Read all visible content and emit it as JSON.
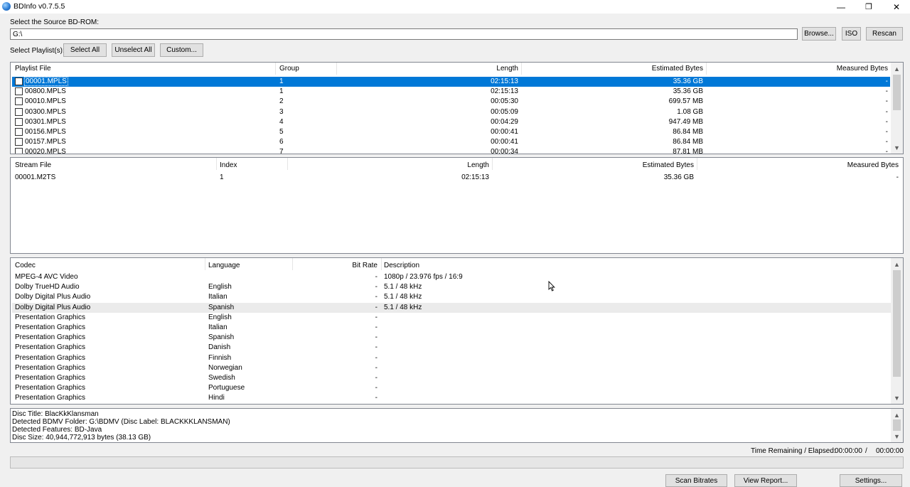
{
  "window": {
    "title": "BDInfo v0.7.5.5",
    "minimize_glyph": "—",
    "restore_glyph": "❐",
    "close_glyph": "✕"
  },
  "source": {
    "label": "Select the Source BD-ROM:",
    "path_value": "G:\\",
    "browse_label": "Browse...",
    "iso_label": "ISO",
    "rescan_label": "Rescan"
  },
  "playlist_select": {
    "label": "Select Playlist(s):",
    "select_all": "Select All",
    "unselect_all": "Unselect All",
    "custom": "Custom..."
  },
  "playlists": {
    "headers": [
      "Playlist File",
      "Group",
      "Length",
      "Estimated Bytes",
      "Measured Bytes"
    ],
    "rows": [
      {
        "file": "00001.MPLS",
        "group": "1",
        "length": "02:15:13",
        "est": "35.36 GB",
        "meas": "-",
        "selected": true
      },
      {
        "file": "00800.MPLS",
        "group": "1",
        "length": "02:15:13",
        "est": "35.36 GB",
        "meas": "-"
      },
      {
        "file": "00010.MPLS",
        "group": "2",
        "length": "00:05:30",
        "est": "699.57 MB",
        "meas": "-"
      },
      {
        "file": "00300.MPLS",
        "group": "3",
        "length": "00:05:09",
        "est": "1.08 GB",
        "meas": "-"
      },
      {
        "file": "00301.MPLS",
        "group": "4",
        "length": "00:04:29",
        "est": "947.49 MB",
        "meas": "-"
      },
      {
        "file": "00156.MPLS",
        "group": "5",
        "length": "00:00:41",
        "est": "86.84 MB",
        "meas": "-"
      },
      {
        "file": "00157.MPLS",
        "group": "6",
        "length": "00:00:41",
        "est": "86.84 MB",
        "meas": "-"
      },
      {
        "file": "00020.MPLS",
        "group": "7",
        "length": "00:00:34",
        "est": "87.81 MB",
        "meas": "-"
      }
    ]
  },
  "streams": {
    "headers": [
      "Stream File",
      "Index",
      "Length",
      "Estimated Bytes",
      "Measured Bytes"
    ],
    "rows": [
      {
        "file": "00001.M2TS",
        "index": "1",
        "length": "02:15:13",
        "est": "35.36 GB",
        "meas": "-"
      }
    ]
  },
  "codecs": {
    "headers": [
      "Codec",
      "Language",
      "Bit Rate",
      "Description"
    ],
    "rows": [
      {
        "codec": "MPEG-4 AVC Video",
        "language": "",
        "bitrate": "-",
        "desc": "1080p / 23.976 fps / 16:9"
      },
      {
        "codec": "Dolby TrueHD Audio",
        "language": "English",
        "bitrate": "-",
        "desc": "5.1 / 48 kHz"
      },
      {
        "codec": "Dolby Digital Plus Audio",
        "language": "Italian",
        "bitrate": "-",
        "desc": "5.1 / 48 kHz"
      },
      {
        "codec": "Dolby Digital Plus Audio",
        "language": "Spanish",
        "bitrate": "-",
        "desc": "5.1 / 48 kHz",
        "hover": true
      },
      {
        "codec": "Presentation Graphics",
        "language": "English",
        "bitrate": "-",
        "desc": ""
      },
      {
        "codec": "Presentation Graphics",
        "language": "Italian",
        "bitrate": "-",
        "desc": ""
      },
      {
        "codec": "Presentation Graphics",
        "language": "Spanish",
        "bitrate": "-",
        "desc": ""
      },
      {
        "codec": "Presentation Graphics",
        "language": "Danish",
        "bitrate": "-",
        "desc": ""
      },
      {
        "codec": "Presentation Graphics",
        "language": "Finnish",
        "bitrate": "-",
        "desc": ""
      },
      {
        "codec": "Presentation Graphics",
        "language": "Norwegian",
        "bitrate": "-",
        "desc": ""
      },
      {
        "codec": "Presentation Graphics",
        "language": "Swedish",
        "bitrate": "-",
        "desc": ""
      },
      {
        "codec": "Presentation Graphics",
        "language": "Portuguese",
        "bitrate": "-",
        "desc": ""
      },
      {
        "codec": "Presentation Graphics",
        "language": "Hindi",
        "bitrate": "-",
        "desc": ""
      }
    ]
  },
  "disc_info": [
    "Disc Title: BlacKkKlansman",
    "Detected BDMV Folder: G:\\BDMV (Disc Label: BLACKKKLANSMAN)",
    "Detected Features: BD-Java",
    "Disc Size: 40,944,772,913 bytes (38.13 GB)"
  ],
  "timer": {
    "label": "Time Remaining / Elapsed:",
    "remaining": "00:00:00",
    "separator": "/",
    "elapsed": "00:00:00"
  },
  "progress": {
    "value": 0
  },
  "footer": {
    "scan_bitrates": "Scan Bitrates",
    "view_report": "View Report...",
    "settings": "Settings..."
  },
  "icons": {
    "scroll_up": "▲",
    "scroll_down": "▼"
  }
}
